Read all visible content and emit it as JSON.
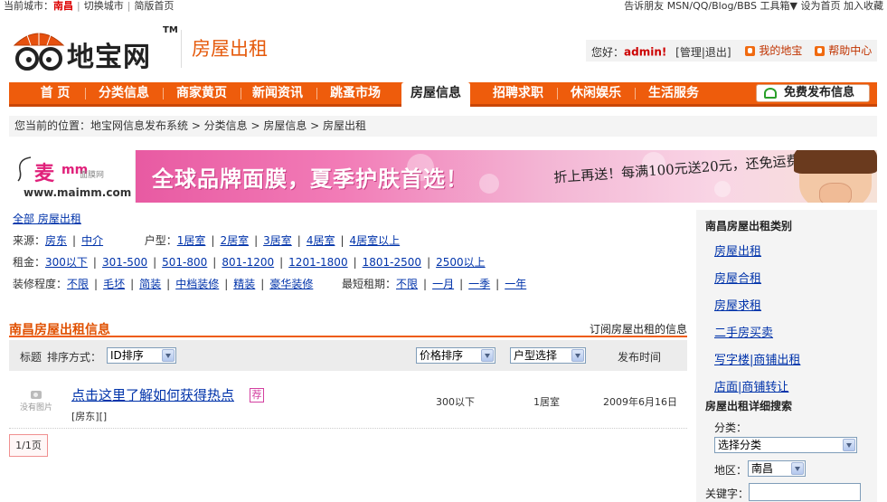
{
  "topbar": {
    "city_label": "当前城市：",
    "city": "南昌",
    "switch_city": "切换城市",
    "simple_version": "简版首页",
    "tell_friends": "告诉朋友",
    "share": "MSN/QQ/Blog/BBS",
    "toolbox": "工具箱▼",
    "set_home": "设为首页",
    "bookmark": "加入收藏"
  },
  "header": {
    "brand": "地宝网",
    "tm": "TM",
    "section": "房屋出租",
    "greeting": "您好：",
    "username": "admin!",
    "manage": "[管理|退出]",
    "my_dibao": "我的地宝",
    "help": "帮助中心"
  },
  "nav": {
    "items": [
      "首 页",
      "分类信息",
      "商家黄页",
      "新闻资讯",
      "跳蚤市场",
      "房屋信息",
      "招聘求职",
      "休闲娱乐",
      "生活服务"
    ],
    "publish": "免费发布信息"
  },
  "breadcrumb": "您当前的位置：地宝网信息发布系统 > 分类信息 > 房屋信息 > 房屋出租",
  "banner": {
    "brand_mai": "麦",
    "brand_mm": "mm",
    "brand_sub": "面膜网",
    "url": "www.maimm.com",
    "slogan": "全球品牌面膜，夏季护肤首选！",
    "promo": "折上再送！每满100元送20元，还免运费"
  },
  "filters": {
    "all": "全部 房屋出租",
    "source_label": "来源：",
    "source": [
      "房东",
      "中介"
    ],
    "type_label": "户型：",
    "type": [
      "1居室",
      "2居室",
      "3居室",
      "4居室",
      "4居室以上"
    ],
    "rent_label": "租金：",
    "rent": [
      "300以下",
      "301-500",
      "501-800",
      "801-1200",
      "1201-1800",
      "1801-2500",
      "2500以上"
    ],
    "deco_label": "装修程度：",
    "deco": [
      "不限",
      "毛坯",
      "简装",
      "中档装修",
      "精装",
      "豪华装修"
    ],
    "term_label": "最短租期：",
    "term": [
      "不限",
      "一月",
      "一季",
      "一年"
    ]
  },
  "list": {
    "title": "南昌房屋出租信息",
    "subscribe": "订阅房屋出租的信息",
    "sort": {
      "title_label": "标题",
      "sort_label": "排序方式：",
      "id_sort": "ID排序",
      "price_sort": "价格排序",
      "type_select": "户型选择",
      "date_label": "发布时间"
    },
    "rows": [
      {
        "no_image": "没有图片",
        "title": "点击这里了解如何获得热点",
        "tag": "荐",
        "meta": "[房东][]",
        "price": "300以下",
        "type": "1居室",
        "date": "2009年6月16日"
      }
    ],
    "pager": "1/1页"
  },
  "sidebar": {
    "cat_title": "南昌房屋出租类别",
    "cats": [
      "房屋出租",
      "房屋合租",
      "房屋求租",
      "二手房买卖",
      "写字楼|商铺出租",
      "店面|商铺转让"
    ],
    "search_title": "房屋出租详细搜索",
    "cat_label": "分类：",
    "cat_select": "选择分类",
    "area_label": "地区：",
    "area_select": "南昌",
    "keyword_label": "关键字："
  },
  "colors": {
    "accent": "#ee5c0c",
    "link": "#0033aa",
    "brand_red": "#d00000"
  }
}
